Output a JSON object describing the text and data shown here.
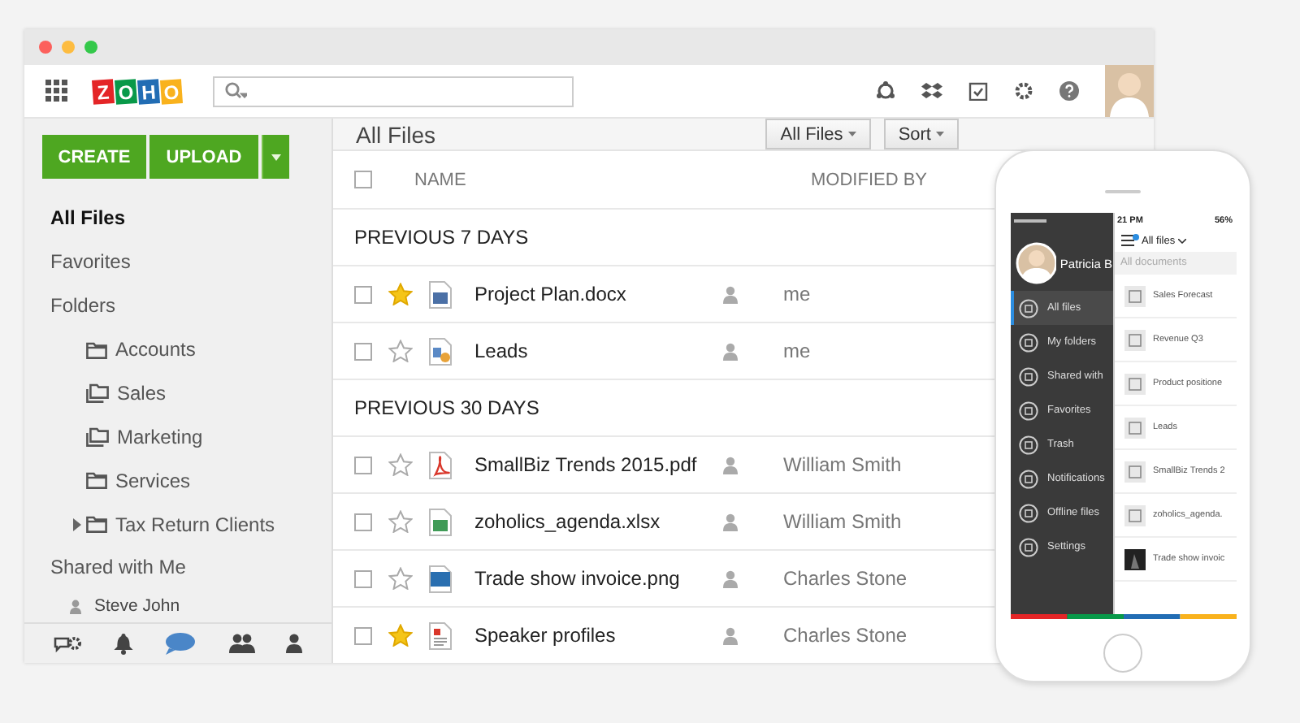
{
  "logo": {
    "letters": [
      {
        "char": "Z",
        "color": "#e42527"
      },
      {
        "char": "O",
        "color": "#089949"
      },
      {
        "char": "H",
        "color": "#226db4"
      },
      {
        "char": "O",
        "color": "#f9b21d"
      }
    ]
  },
  "toolbar": {
    "icons": [
      {
        "kind": "share"
      },
      {
        "kind": "dropbox"
      },
      {
        "kind": "tasks"
      },
      {
        "kind": "settings"
      },
      {
        "kind": "help"
      }
    ]
  },
  "sidebar": {
    "buttons": [
      "CREATE",
      "UPLOAD"
    ],
    "nav": [
      {
        "label": "All Files",
        "selected": true
      },
      {
        "label": "Favorites",
        "selected": false
      },
      {
        "label": "Folders",
        "selected": false
      }
    ],
    "folders": [
      {
        "label": "Accounts",
        "kind": "plain",
        "expandable": false
      },
      {
        "label": "Sales",
        "kind": "shared",
        "expandable": false
      },
      {
        "label": "Marketing",
        "kind": "shared",
        "expandable": false
      },
      {
        "label": "Services",
        "kind": "plain",
        "expandable": false
      },
      {
        "label": "Tax Return Clients",
        "kind": "plain",
        "expandable": true
      }
    ],
    "shared_heading": "Shared with Me",
    "shared_users": [
      "Steve John"
    ],
    "bottom_icons": [
      {
        "kind": "gear"
      },
      {
        "kind": "bell"
      },
      {
        "kind": "chat"
      },
      {
        "kind": "people"
      },
      {
        "kind": "person"
      }
    ]
  },
  "main": {
    "title": "All Files",
    "filters": [
      "All Files",
      "Sort"
    ],
    "select_all_checked": false,
    "columns": [
      "NAME",
      "MODIFIED BY"
    ],
    "groups": [
      {
        "heading": "PREVIOUS 7 DAYS",
        "rows": [
          {
            "name": "Project Plan.docx",
            "kind": "docx",
            "starred": true,
            "checked": false,
            "modified_by": "me"
          },
          {
            "name": "Leads",
            "kind": "report",
            "starred": false,
            "checked": false,
            "modified_by": "me"
          }
        ]
      },
      {
        "heading": "PREVIOUS 30 DAYS",
        "rows": [
          {
            "name": "SmallBiz Trends 2015.pdf",
            "kind": "pdf",
            "starred": false,
            "checked": false,
            "modified_by": "William Smith"
          },
          {
            "name": "zoholics_agenda.xlsx",
            "kind": "xlsx",
            "starred": false,
            "checked": false,
            "modified_by": "William Smith"
          },
          {
            "name": "Trade show invoice.png",
            "kind": "png",
            "starred": false,
            "checked": false,
            "modified_by": "Charles Stone"
          },
          {
            "name": "Speaker profiles",
            "kind": "doc",
            "starred": true,
            "checked": false,
            "modified_by": "Charles Stone"
          }
        ]
      }
    ]
  },
  "phone": {
    "time": "21 PM",
    "battery": "56%",
    "user": "Patricia B",
    "drawer": [
      {
        "label": "All files",
        "selected": true
      },
      {
        "label": "My folders",
        "selected": false
      },
      {
        "label": "Shared with",
        "selected": false
      },
      {
        "label": "Favorites",
        "selected": false
      },
      {
        "label": "Trash",
        "selected": false
      },
      {
        "label": "Notifications",
        "selected": false
      },
      {
        "label": "Offline files",
        "selected": false
      },
      {
        "label": "Settings",
        "selected": false
      }
    ],
    "header": "All files",
    "section": "All documents",
    "files": [
      {
        "name": "Sales Forecast",
        "kind": "doc"
      },
      {
        "name": "Revenue Q3",
        "kind": "doc"
      },
      {
        "name": "Product positione",
        "kind": "doc"
      },
      {
        "name": "Leads",
        "kind": "doc"
      },
      {
        "name": "SmallBiz Trends 2",
        "kind": "doc"
      },
      {
        "name": "zoholics_agenda.",
        "kind": "doc"
      },
      {
        "name": "Trade show invoic"
      }
    ]
  }
}
